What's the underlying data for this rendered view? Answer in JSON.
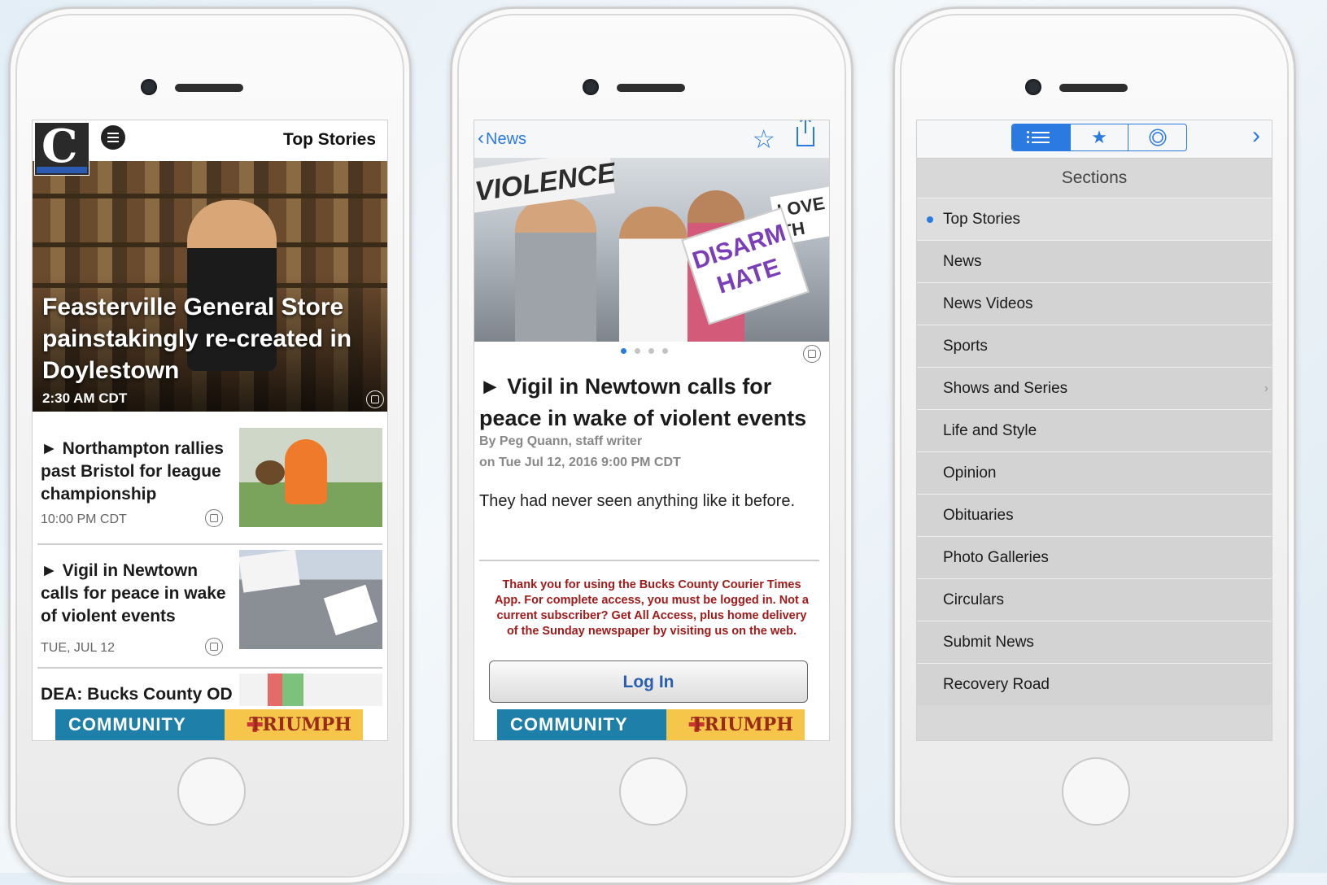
{
  "phone1": {
    "header_title": "Top Stories",
    "hero": {
      "headline": "Feasterville General Store painstakingly re-created in Doylestown",
      "time": "2:30 AM CDT"
    },
    "stories": [
      {
        "headline": "► Northampton rallies past Bristol for league championship",
        "time": "10:00 PM CDT"
      },
      {
        "headline": "► Vigil in Newtown calls for peace in wake of violent events",
        "time": "TUE, JUL 12"
      },
      {
        "headline": "DEA: Bucks County OD",
        "time": ""
      }
    ],
    "ad": {
      "left": "COMMUNITY",
      "right": "TRIUMPH"
    }
  },
  "phone2": {
    "back_label": "News",
    "photo_signs": {
      "sign1": "VIOLENCE",
      "sign2": "DISARM HATE",
      "sign3": "I OVE TH"
    },
    "headline": "► Vigil in Newtown calls for peace in wake of violent events",
    "byline": "By Peg Quann, staff writer",
    "date": "on Tue Jul 12, 2016 9:00 PM CDT",
    "lead": "They had never seen anything like it before.",
    "notice": "Thank you for using the Bucks County Courier Times App. For complete access, you must be logged in. Not a current subscriber? Get All Access, plus home delivery of the Sunday newspaper by visiting us on the web.",
    "login_label": "Log In",
    "ad": {
      "left": "COMMUNITY",
      "right": "TRIUMPH"
    }
  },
  "phone3": {
    "title": "Sections",
    "items": [
      {
        "label": "Top Stories",
        "selected": true
      },
      {
        "label": "News"
      },
      {
        "label": "News Videos"
      },
      {
        "label": "Sports"
      },
      {
        "label": "Shows and Series"
      },
      {
        "label": "Life and Style"
      },
      {
        "label": "Opinion"
      },
      {
        "label": "Obituaries"
      },
      {
        "label": "Photo Galleries"
      },
      {
        "label": "Circulars"
      },
      {
        "label": "Submit News"
      },
      {
        "label": "Recovery Road"
      }
    ]
  },
  "colors": {
    "accent": "#2a7ae2",
    "notice": "#a11a1a"
  }
}
